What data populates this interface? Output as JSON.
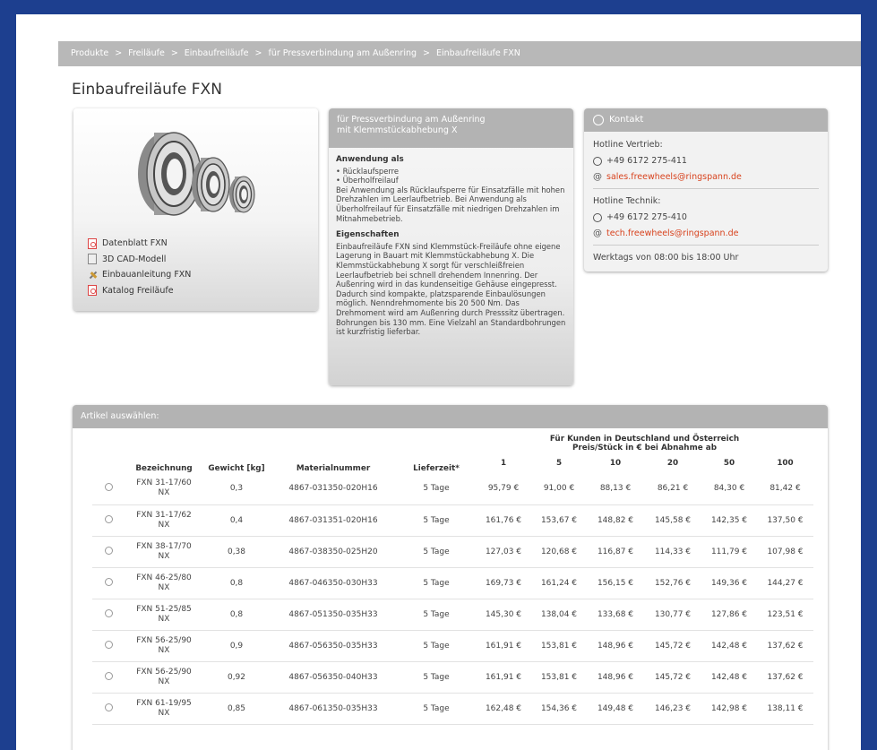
{
  "breadcrumb": [
    "Produkte",
    "Freiläufe",
    "Einbaufreiläufe",
    "für Pressverbindung am Außenring",
    "Einbaufreiläufe FXN"
  ],
  "breadcrumb_sep": ">",
  "page_title": "Einbaufreiläufe FXN",
  "product_links": [
    {
      "label": "Datenblatt FXN",
      "icon": "pdf-icon"
    },
    {
      "label": "3D CAD-Modell",
      "icon": "cad-icon"
    },
    {
      "label": "Einbauanleitung FXN",
      "icon": "tool-icon"
    },
    {
      "label": "Katalog Freiläufe",
      "icon": "pdf-icon"
    }
  ],
  "description": {
    "header_line1": "für Pressverbindung am Außenring",
    "header_line2": "mit Klemmstückabhebung X",
    "usage_title": "Anwendung als",
    "usage_items": [
      "Rücklaufsperre",
      "Überholfreilauf"
    ],
    "usage_text": "Bei Anwendung als Rücklaufsperre für Einsatzfälle mit hohen Drehzahlen im Leerlaufbetrieb. Bei Anwendung als Überholfreilauf für Einsatzfälle mit niedrigen Drehzahlen im Mitnahmebetrieb.",
    "props_title": "Eigenschaften",
    "props_text": "Einbaufreiläufe FXN sind Klemmstück-Freiläufe ohne eigene Lagerung in Bauart mit Klemmstückabhebung X. Die Klemmstückabhebung X sorgt für verschleißfreien Leerlaufbetrieb bei schnell drehendem Innenring. Der Außenring wird in das kundenseitige Gehäuse eingepresst. Dadurch sind kompakte, platzsparende Einbaulösungen möglich. Nenndrehmomente bis 20 500 Nm. Das Drehmoment wird am Außenring durch Presssitz übertragen. Bohrungen bis 130 mm. Eine Vielzahl an Standardbohrungen ist kurzfristig lieferbar."
  },
  "contact": {
    "title": "Kontakt",
    "sales_label": "Hotline Vertrieb:",
    "sales_phone": "+49 6172 275-411",
    "sales_email": "sales.freewheels@ringspann.de",
    "tech_label": "Hotline Technik:",
    "tech_phone": "+49 6172 275-410",
    "tech_email": "tech.freewheels@ringspann.de",
    "hours": "Werktags von 08:00 bis 18:00 Uhr"
  },
  "articles": {
    "title": "Artikel auswählen:",
    "col_bezeichnung": "Bezeichnung",
    "col_gewicht": "Gewicht [kg]",
    "col_material": "Materialnummer",
    "col_lieferzeit": "Lieferzeit*",
    "price_header_line1": "Für Kunden in Deutschland und Österreich",
    "price_header_line2": "Preis/Stück in € bei Abnahme ab",
    "quantities": [
      "1",
      "5",
      "10",
      "20",
      "50",
      "100"
    ],
    "rows": [
      {
        "name1": "FXN 31-17/60",
        "name2": "NX",
        "weight": "0,3",
        "material": "4867-031350-020H16",
        "delivery": "5 Tage",
        "prices": [
          "95,79 €",
          "91,00 €",
          "88,13 €",
          "86,21 €",
          "84,30 €",
          "81,42 €"
        ]
      },
      {
        "name1": "FXN 31-17/62",
        "name2": "NX",
        "weight": "0,4",
        "material": "4867-031351-020H16",
        "delivery": "5 Tage",
        "prices": [
          "161,76 €",
          "153,67 €",
          "148,82 €",
          "145,58 €",
          "142,35 €",
          "137,50 €"
        ]
      },
      {
        "name1": "FXN 38-17/70",
        "name2": "NX",
        "weight": "0,38",
        "material": "4867-038350-025H20",
        "delivery": "5 Tage",
        "prices": [
          "127,03 €",
          "120,68 €",
          "116,87 €",
          "114,33 €",
          "111,79 €",
          "107,98 €"
        ]
      },
      {
        "name1": "FXN 46-25/80",
        "name2": "NX",
        "weight": "0,8",
        "material": "4867-046350-030H33",
        "delivery": "5 Tage",
        "prices": [
          "169,73 €",
          "161,24 €",
          "156,15 €",
          "152,76 €",
          "149,36 €",
          "144,27 €"
        ]
      },
      {
        "name1": "FXN 51-25/85",
        "name2": "NX",
        "weight": "0,8",
        "material": "4867-051350-035H33",
        "delivery": "5 Tage",
        "prices": [
          "145,30 €",
          "138,04 €",
          "133,68 €",
          "130,77 €",
          "127,86 €",
          "123,51 €"
        ]
      },
      {
        "name1": "FXN 56-25/90",
        "name2": "NX",
        "weight": "0,9",
        "material": "4867-056350-035H33",
        "delivery": "5 Tage",
        "prices": [
          "161,91 €",
          "153,81 €",
          "148,96 €",
          "145,72 €",
          "142,48 €",
          "137,62 €"
        ]
      },
      {
        "name1": "FXN 56-25/90",
        "name2": "NX",
        "weight": "0,92",
        "material": "4867-056350-040H33",
        "delivery": "5 Tage",
        "prices": [
          "161,91 €",
          "153,81 €",
          "148,96 €",
          "145,72 €",
          "142,48 €",
          "137,62 €"
        ]
      },
      {
        "name1": "FXN 61-19/95",
        "name2": "NX",
        "weight": "0,85",
        "material": "4867-061350-035H33",
        "delivery": "5 Tage",
        "prices": [
          "162,48 €",
          "154,36 €",
          "149,48 €",
          "146,23 €",
          "142,98 €",
          "138,11 €"
        ]
      }
    ]
  },
  "colors": {
    "frame_blue": "#1d3f8f",
    "panel_gray": "#b3b3b3",
    "link_red": "#d8431e"
  }
}
